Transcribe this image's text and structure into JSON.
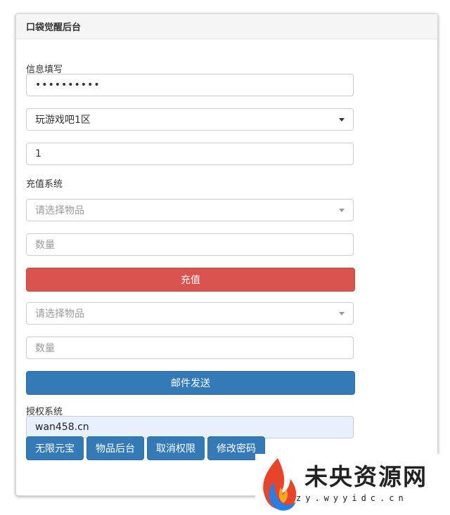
{
  "panel": {
    "title": "口袋觉醒后台"
  },
  "info": {
    "section_label": "信息填写",
    "password_value": "••••••••••",
    "server_selected": "玩游戏吧1区",
    "role_value": "1"
  },
  "recharge": {
    "section_label": "充值系统",
    "item_placeholder": "请选择物品",
    "qty_placeholder": "数量",
    "recharge_button": "充值"
  },
  "mail": {
    "item_placeholder": "请选择物品",
    "qty_placeholder": "数量",
    "send_button": "邮件发送"
  },
  "auth": {
    "section_label": "授权系统",
    "code_value": "wan458.cn",
    "buttons": [
      "无限元宝",
      "物品后台",
      "取消权限",
      "修改密码"
    ]
  },
  "watermark": {
    "title": "未央资源网",
    "subtitle": "zy.wyyidc.cn",
    "colors": {
      "flame_red": "#e8432b",
      "flame_blue": "#2a7de1",
      "flame_orange": "#f5a623"
    }
  },
  "colors": {
    "primary": "#337ab7",
    "danger": "#d9534f",
    "autofill": "#e8f0fe"
  }
}
